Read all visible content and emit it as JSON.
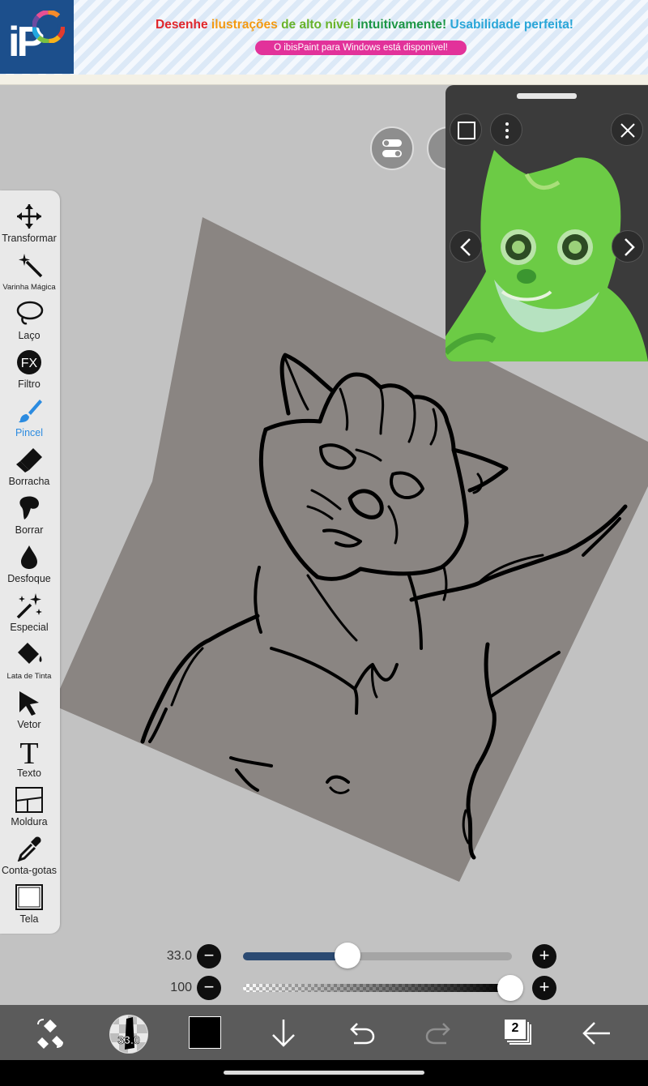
{
  "banner": {
    "logo_text": "iP",
    "title_segments": [
      {
        "text": "Desenhe ",
        "color": "#e0262b"
      },
      {
        "text": "ilustrações ",
        "color": "#f39a12"
      },
      {
        "text": "de alto nível ",
        "color": "#68b32a"
      },
      {
        "text": "intuitivamente! ",
        "color": "#1c9645"
      },
      {
        "text": "Usabilidade perfeita!",
        "color": "#2aa6d8"
      }
    ],
    "subtitle": "O ibisPaint para Windows está disponível!"
  },
  "toolbar": {
    "tools": [
      {
        "label": "Transformar",
        "icon": "move-arrows-icon"
      },
      {
        "label": "Varinha Mágica",
        "icon": "magic-wand-icon"
      },
      {
        "label": "Laço",
        "icon": "lasso-icon"
      },
      {
        "label": "Filtro",
        "icon": "fx-icon",
        "icon_text": "FX"
      },
      {
        "label": "Pincel",
        "icon": "brush-icon",
        "active": true
      },
      {
        "label": "Borracha",
        "icon": "eraser-icon"
      },
      {
        "label": "Borrar",
        "icon": "smudge-icon"
      },
      {
        "label": "Desfoque",
        "icon": "blur-drop-icon"
      },
      {
        "label": "Especial",
        "icon": "sparkle-icon"
      },
      {
        "label": "Lata de Tinta",
        "icon": "fill-bucket-icon"
      },
      {
        "label": "Vetor",
        "icon": "vector-cursor-icon"
      },
      {
        "label": "Texto",
        "icon": "text-icon",
        "icon_text": "T"
      },
      {
        "label": "Moldura",
        "icon": "frame-icon"
      },
      {
        "label": "Conta-gotas",
        "icon": "eyedropper-icon"
      },
      {
        "label": "Tela",
        "icon": "canvas-icon"
      }
    ],
    "active_color": "#2b8be0"
  },
  "sliders": {
    "brush_size": {
      "label": "33.0",
      "value_fraction": 0.39
    },
    "opacity": {
      "label": "100",
      "value_fraction": 1.0
    }
  },
  "bottom_bar": {
    "brush_size_badge": "33.0",
    "current_color": "#000000",
    "layers_count": "2"
  },
  "colors": {
    "canvas_background": "#c2c2c2",
    "paper": "#8a8582",
    "toolbar": "#e9e9e9",
    "bottom_bar": "#5b5b5b"
  }
}
